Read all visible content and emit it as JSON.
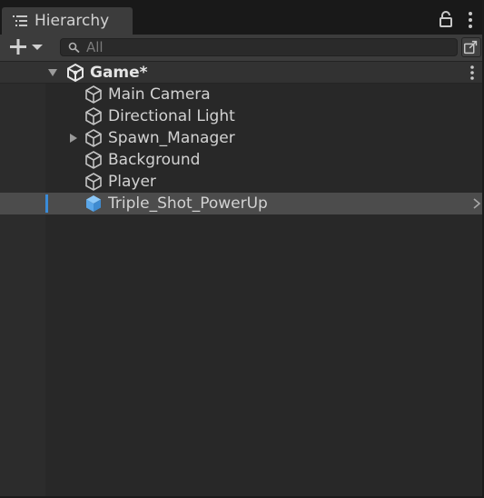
{
  "window": {
    "tab_label": "Hierarchy",
    "tab_icon": "list-icon",
    "lock_icon": "lock-icon",
    "menu_icon": "kebab-menu-icon"
  },
  "toolbar": {
    "add_icon": "plus-icon",
    "dropdown_icon": "chevron-down-icon",
    "search": {
      "icon": "search-icon",
      "value": "",
      "placeholder": "All"
    },
    "scene_visibility_icon": "scene-visibility-icon"
  },
  "scene": {
    "name": "Game*",
    "expanded": true,
    "icon": "unity-scene-icon",
    "menu_icon": "kebab-menu-icon"
  },
  "objects": [
    {
      "name": "Main Camera",
      "icon": "gameobject-cube-icon",
      "has_children": false,
      "selected": false
    },
    {
      "name": "Directional Light",
      "icon": "gameobject-cube-icon",
      "has_children": false,
      "selected": false
    },
    {
      "name": "Spawn_Manager",
      "icon": "gameobject-cube-icon",
      "has_children": true,
      "selected": false
    },
    {
      "name": "Background",
      "icon": "gameobject-cube-icon",
      "has_children": false,
      "selected": false
    },
    {
      "name": "Player",
      "icon": "gameobject-cube-icon",
      "has_children": false,
      "selected": false
    },
    {
      "name": "Triple_Shot_PowerUp",
      "icon": "prefab-cube-icon",
      "has_children": false,
      "selected": true
    }
  ],
  "colors": {
    "selection_bar": "#3a8bd8",
    "prefab_icon": "#69b4f0",
    "gameobject_icon": "#c4c4c4"
  }
}
